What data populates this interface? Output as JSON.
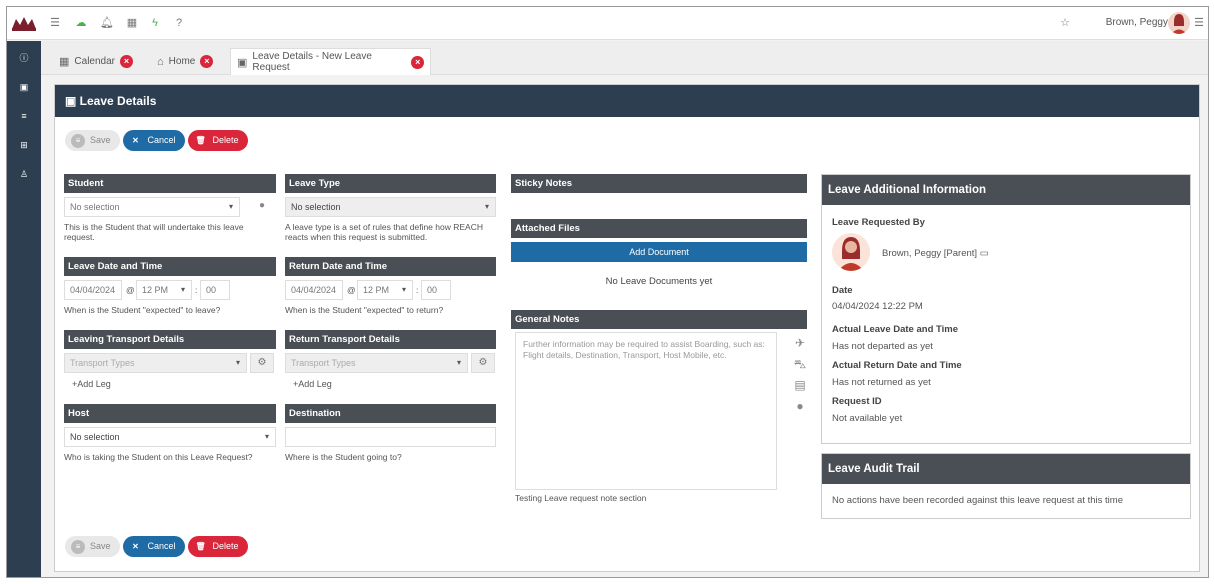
{
  "header": {
    "user_name": "Brown, Peggy"
  },
  "tabs": [
    {
      "label": "Calendar"
    },
    {
      "label": "Home"
    },
    {
      "label": "Leave Details - New Leave Request"
    }
  ],
  "panel": {
    "title": "Leave Details"
  },
  "actions": {
    "save": "Save",
    "cancel": "Cancel",
    "delete": "Delete"
  },
  "student": {
    "header": "Student",
    "value": "No selection",
    "help": "This is the Student that will undertake this leave request."
  },
  "leave_type": {
    "header": "Leave Type",
    "value": "No selection",
    "help": "A leave type is a set of rules that define how REACH reacts when this request is submitted."
  },
  "leave_date": {
    "header": "Leave Date and Time",
    "date": "04/04/2024",
    "at": "@",
    "hour": "12 PM",
    "colon": ":",
    "minute": "00",
    "help": "When is the Student \"expected\" to leave?"
  },
  "return_date": {
    "header": "Return Date and Time",
    "date": "04/04/2024",
    "at": "@",
    "hour": "12 PM",
    "colon": ":",
    "minute": "00",
    "help": "When is the Student \"expected\" to return?"
  },
  "leaving_transport": {
    "header": "Leaving Transport Details",
    "placeholder": "Transport Types",
    "add_leg": "Add Leg"
  },
  "return_transport": {
    "header": "Return Transport Details",
    "placeholder": "Transport Types",
    "add_leg": "Add Leg"
  },
  "host": {
    "header": "Host",
    "value": "No selection",
    "help": "Who is taking the Student on this Leave Request?"
  },
  "destination": {
    "header": "Destination",
    "value": "",
    "help": "Where is the Student going to?"
  },
  "sticky_notes": {
    "header": "Sticky Notes"
  },
  "attached_files": {
    "header": "Attached Files",
    "add_button": "Add Document",
    "empty": "No Leave Documents yet"
  },
  "general_notes": {
    "header": "General Notes",
    "placeholder": "Further information may be required to assist Boarding, such as: Flight details, Destination, Transport, Host Mobile, etc.",
    "footer": "Testing Leave request note section"
  },
  "additional_info": {
    "header": "Leave Additional Information",
    "requested_by_label": "Leave Requested By",
    "requested_by_name": "Brown, Peggy [Parent]",
    "date_label": "Date",
    "date_value": "04/04/2024 12:22 PM",
    "actual_leave_label": "Actual Leave Date and Time",
    "actual_leave_value": "Has not departed as yet",
    "actual_return_label": "Actual Return Date and Time",
    "actual_return_value": "Has not returned as yet",
    "request_id_label": "Request ID",
    "request_id_value": "Not available yet"
  },
  "audit_trail": {
    "header": "Leave Audit Trail",
    "message": "No actions have been recorded against this leave request at this time"
  },
  "colors": {
    "nav": "#2c3e50",
    "section": "#4a4f55",
    "primary": "#1e6ba6",
    "danger": "#d9263a"
  }
}
